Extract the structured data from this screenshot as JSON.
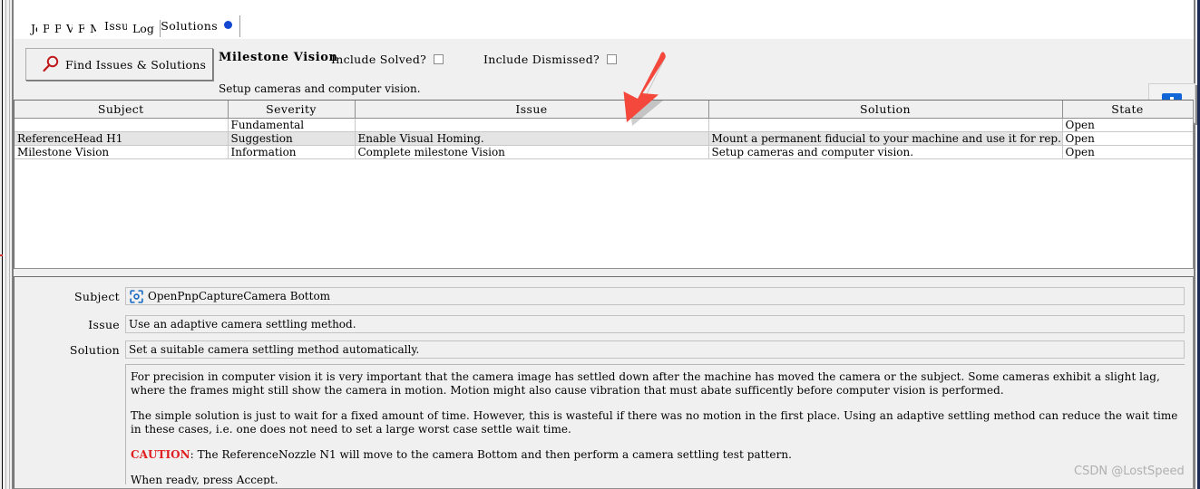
{
  "tabs": [
    {
      "label": "Job",
      "active": false,
      "badge": false
    },
    {
      "label": "Parts",
      "active": false,
      "badge": false
    },
    {
      "label": "Packages",
      "active": false,
      "badge": false
    },
    {
      "label": "Vision",
      "active": false,
      "badge": false
    },
    {
      "label": "Feeders",
      "active": false,
      "badge": false
    },
    {
      "label": "Machine Setup",
      "active": false,
      "badge": false
    },
    {
      "label": "Issues & Solutions",
      "active": true,
      "badge": true
    },
    {
      "label": "Log",
      "active": false,
      "badge": false
    }
  ],
  "toolbar": {
    "find_button_label": "Find Issues & Solutions",
    "find_icon": "magnifier-icon",
    "milestone_title": "Milestone Vision",
    "milestone_subtitle": "Setup cameras and computer vision.",
    "include_solved_label": "Include Solved?",
    "include_solved_checked": false,
    "include_dismissed_label": "Include Dismissed?",
    "include_dismissed_checked": false,
    "info_button_icon": "info-icon"
  },
  "table": {
    "columns": [
      "Subject",
      "Severity",
      "Issue",
      "Solution",
      "State"
    ],
    "rows": [
      {
        "subject": "OpenPnpCaptureCamera Bottom",
        "severity": "Fundamental",
        "issue": "Use an adaptive camera settling method.",
        "solution": "Set a suitable camera settling method automatically.",
        "state": "Open"
      },
      {
        "subject": "ReferenceHead H1",
        "severity": "Suggestion",
        "issue": "Enable Visual Homing.",
        "solution": "Mount a permanent fiducial to your machine and use it for rep...",
        "state": "Open"
      },
      {
        "subject": "Milestone Vision",
        "severity": "Information",
        "issue": "Complete milestone Vision",
        "solution": "Setup cameras and computer vision.",
        "state": "Open"
      }
    ]
  },
  "detail": {
    "subject_label": "Subject",
    "subject_value": "OpenPnpCaptureCamera Bottom",
    "subject_icon": "camera-icon",
    "issue_label": "Issue",
    "issue_value": "Use an adaptive camera settling method.",
    "solution_label": "Solution",
    "solution_value": "Set a suitable camera settling method automatically.",
    "description": {
      "paragraph_1": "For precision in computer vision it is very important that the camera image has settled down after the machine has moved the camera or the subject. Some cameras exhibit a slight lag, where the frames might still show the camera in motion. Motion might also cause vibration that must abate sufficently before computer vision is performed.",
      "paragraph_2": "The simple solution is just to wait for a fixed amount of time. However, this is wasteful if there was no motion in the first place. Using an adaptive settling method can reduce the wait time in these cases, i.e. one does not need to set a large worst case settle wait time.",
      "caution_word": "CAUTION",
      "caution_text": ": The ReferenceNozzle N1 will move to the camera Bottom and then perform a camera settling test pattern.",
      "paragraph_4": "When ready, press Accept."
    }
  },
  "annotation": {
    "arrow": "red-down-left-arrow"
  },
  "watermark": "CSDN @LostSpeed",
  "colors": {
    "selection_blue": "#1476d2",
    "selection_soft_blue": "#b9d6f2",
    "suggestion_yellow": "#fbfbad",
    "badge_blue": "#1147d1",
    "info_blue": "#1167d8",
    "caution_red": "#e02020",
    "arrow_red": "#f4483c",
    "panel_gray": "#f0f0f0"
  }
}
